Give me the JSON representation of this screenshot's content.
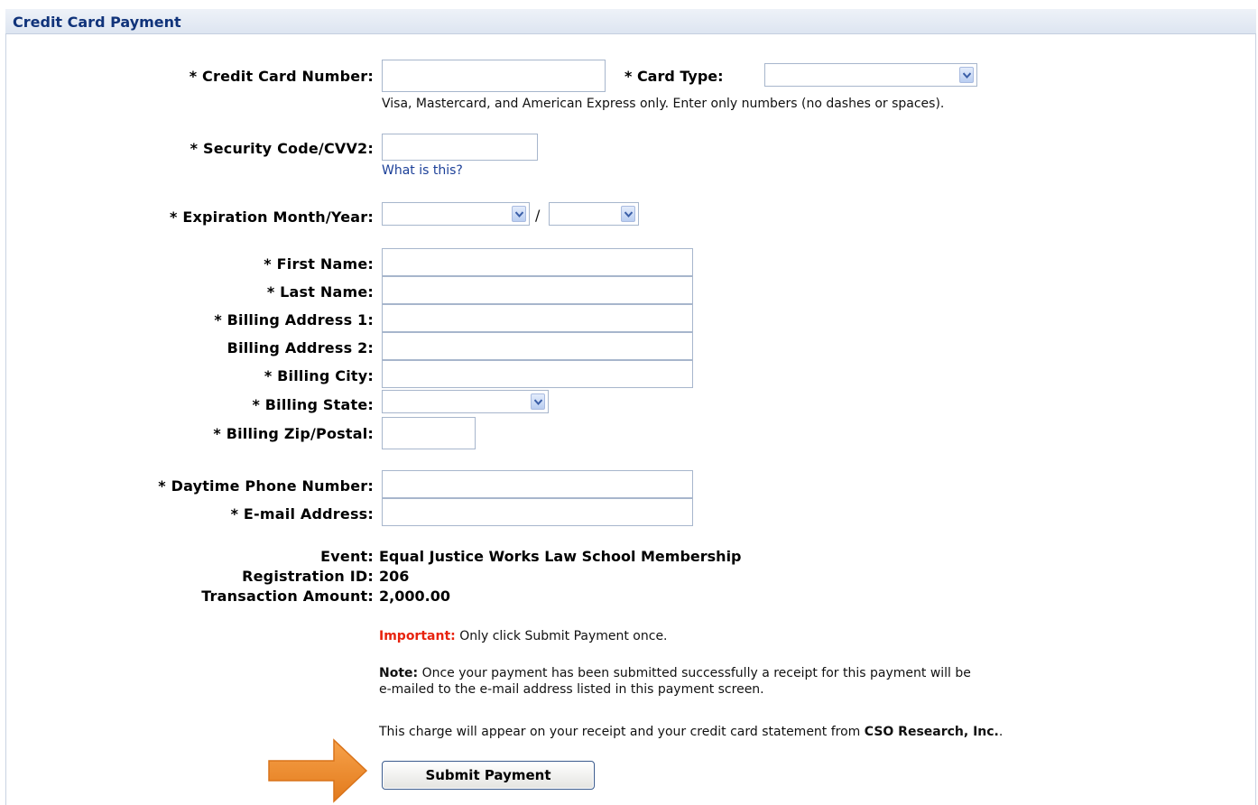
{
  "header": {
    "title": "Credit Card Payment"
  },
  "form": {
    "card_number_label": "* Credit Card Number:",
    "card_number_value": "",
    "card_type_label": "* Card Type:",
    "card_type_value": "",
    "card_hint": "Visa, Mastercard, and American Express only. Enter only numbers (no dashes or spaces).",
    "security_label": "* Security Code/CVV2:",
    "security_value": "",
    "security_link": "What is this?",
    "expiration_label": "* Expiration Month/Year:",
    "expiration_separator": "/",
    "first_name_label": "* First Name:",
    "last_name_label": "* Last Name:",
    "address1_label": "* Billing Address 1:",
    "address2_label": "Billing Address 2:",
    "city_label": "* Billing City:",
    "state_label": "* Billing State:",
    "zip_label": "* Billing Zip/Postal:",
    "phone_label": "* Daytime Phone Number:",
    "email_label": "* E-mail Address:"
  },
  "summary": {
    "event_label": "Event:",
    "event_value": "Equal Justice Works Law School Membership",
    "registration_label": "Registration ID:",
    "registration_value": "206",
    "amount_label": "Transaction Amount:",
    "amount_value": "2,000.00"
  },
  "notices": {
    "important_label": "Important:",
    "important_text": " Only click Submit Payment once.",
    "note_label": "Note:",
    "note_line1": " Once your payment has been submitted successfully a receipt for this payment will be",
    "note_line2": "e-mailed to the e-mail address listed in this payment screen.",
    "charge_text": "This charge will appear on your receipt and your credit card statement from ",
    "company": "CSO Research, Inc.",
    "charge_end": "."
  },
  "actions": {
    "submit_label": "Submit Payment"
  },
  "colors": {
    "title": "#10337a",
    "important": "#e8230e",
    "link": "#1b3f98",
    "arrow": "#f08a2c"
  }
}
